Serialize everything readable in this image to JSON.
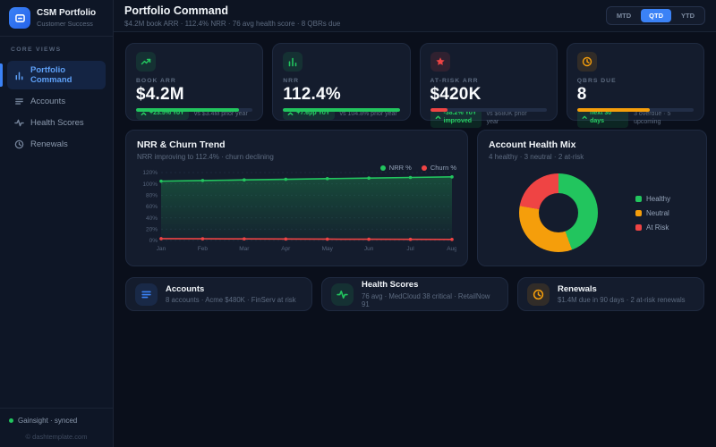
{
  "sidebar": {
    "brand": {
      "name": "CSM Portfolio",
      "subtitle": "Customer Success"
    },
    "section_label": "CORE VIEWS",
    "items": [
      {
        "label": "Portfolio Command",
        "icon": "bar-chart-icon",
        "active": true
      },
      {
        "label": "Accounts",
        "icon": "list-icon",
        "active": false
      },
      {
        "label": "Health Scores",
        "icon": "activity-icon",
        "active": false
      },
      {
        "label": "Renewals",
        "icon": "clock-icon",
        "active": false
      }
    ],
    "footer": {
      "status": "Gainsight · synced",
      "copyright": "© dashtemplate.com"
    }
  },
  "header": {
    "title": "Portfolio Command",
    "subtitle": "$4.2M book ARR · 112.4% NRR · 76 avg health score · 8 QBRs due",
    "range_toggle": {
      "options": [
        "MTD",
        "QTD",
        "YTD"
      ],
      "selected": "QTD"
    }
  },
  "kpis": [
    {
      "label": "BOOK ARR",
      "value": "$4.2M",
      "badge": "+23.5% YoY",
      "sub": "vs $3.4M prior year",
      "icon": "trending-up-icon",
      "accent": "#22c55e",
      "progress_pct": 88,
      "progress_color": "#22c55e"
    },
    {
      "label": "NRR",
      "value": "112.4%",
      "badge": "+7.6pp YoY",
      "sub": "vs 104.8% prior year",
      "icon": "bar-chart-icon",
      "accent": "#22c55e",
      "progress_pct": 100,
      "progress_color": "#22c55e"
    },
    {
      "label": "AT-RISK ARR",
      "value": "$420K",
      "badge": "-38.2% YoY",
      "badge2": "improved",
      "sub": "vs $680K prior year",
      "icon": "alert-icon",
      "accent": "#ef4444",
      "progress_pct": 15,
      "progress_color": "#ef4444"
    },
    {
      "label": "QBRS DUE",
      "value": "8",
      "badge": "next 30 days",
      "sub": "3 overdue · 5 upcoming",
      "icon": "clock-icon",
      "accent": "#f59e0b",
      "progress_pct": 62,
      "progress_color": "#f59e0b"
    }
  ],
  "chart_data": [
    {
      "type": "line",
      "title": "NRR & Churn Trend",
      "subtitle": "NRR improving to 112.4% · churn declining",
      "x": [
        "Jan",
        "Feb",
        "Mar",
        "Apr",
        "May",
        "Jun",
        "Jul",
        "Aug"
      ],
      "series": [
        {
          "name": "NRR %",
          "color": "#22c55e",
          "area": true,
          "values": [
            104.8,
            105.9,
            107.0,
            108.1,
            109.2,
            110.2,
            111.3,
            112.4
          ]
        },
        {
          "name": "Churn %",
          "color": "#ef4444",
          "area": false,
          "values": [
            3.2,
            3.0,
            2.8,
            2.6,
            2.4,
            2.2,
            2.0,
            1.8
          ]
        }
      ],
      "ylim": [
        0,
        120
      ],
      "yticks": [
        0,
        20,
        40,
        60,
        80,
        100,
        120
      ],
      "ytick_suffix": "%",
      "grid": true,
      "legend_position": "top-right"
    },
    {
      "type": "pie",
      "donut": true,
      "title": "Account Health Mix",
      "subtitle": "4 healthy · 3 neutral · 2 at-risk",
      "labels": [
        "Healthy",
        "Neutral",
        "At Risk"
      ],
      "values": [
        4,
        3,
        2
      ],
      "colors": [
        "#22c55e",
        "#f59e0b",
        "#ef4444"
      ],
      "legend_position": "right"
    }
  ],
  "bottom_cards": [
    {
      "title": "Accounts",
      "subtitle": "8 accounts · Acme $480K · FinServ at risk",
      "icon": "list-icon",
      "accent": "#3b82f6"
    },
    {
      "title": "Health Scores",
      "subtitle": "76 avg · MedCloud 38 critical · RetailNow 91",
      "icon": "activity-icon",
      "accent": "#22c55e"
    },
    {
      "title": "Renewals",
      "subtitle": "$1.4M due in 90 days · 2 at-risk renewals",
      "icon": "clock-icon",
      "accent": "#f59e0b"
    }
  ]
}
